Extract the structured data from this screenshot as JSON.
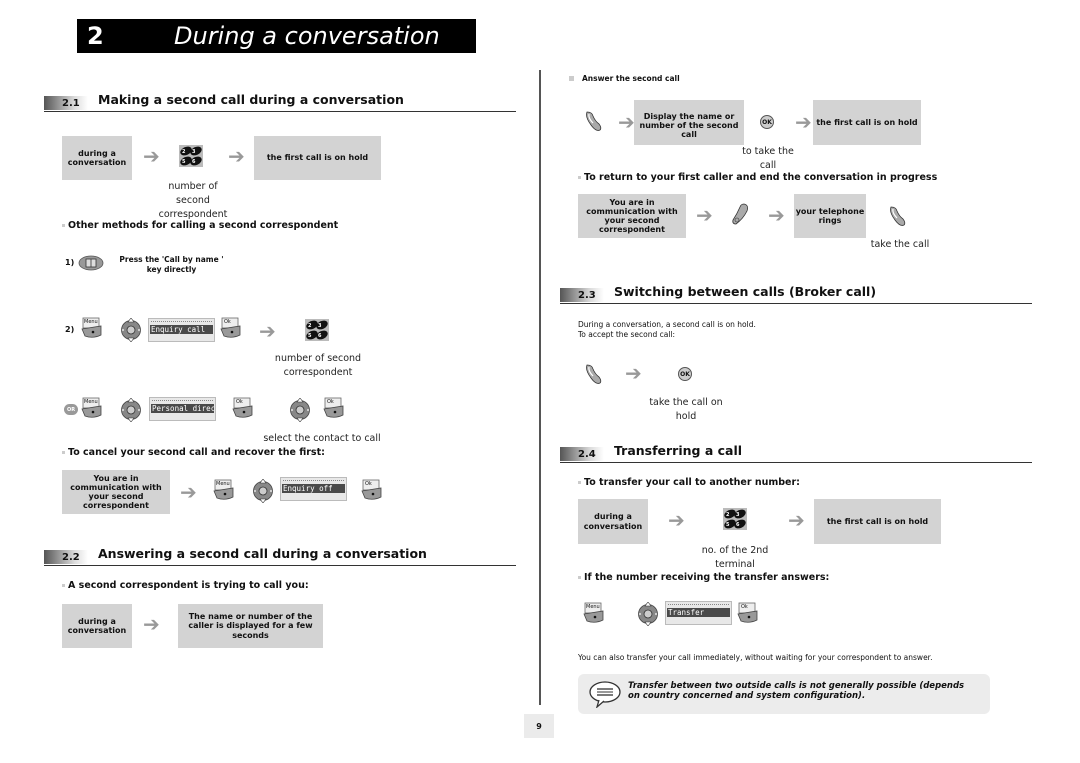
{
  "chapter": {
    "number": "2",
    "title": "During a conversation"
  },
  "sections": {
    "s21": {
      "number": "2.1",
      "title": "Making a second call during a conversation",
      "flow": {
        "box1": "during a conversation",
        "keypad_caption": "number of second correspondent",
        "box2": "the first call is on hold"
      },
      "bullet_other": "Other methods for calling a second correspondent",
      "method1": {
        "label": "1)",
        "text": "Press the 'Call by name ' key directly"
      },
      "method2": {
        "label": "2)",
        "menu_key": "Menu",
        "lcd": "Enquiry call",
        "ok_key": "Ok",
        "keypad_caption": "number of second correspondent"
      },
      "method_or": {
        "or_label": "OR",
        "menu_key": "Menu",
        "lcd": "Personal directory",
        "ok_key": "Ok",
        "ok_key2": "Ok",
        "caption": "select the contact to call"
      },
      "bullet_cancel": "To cancel your second call and recover the first:",
      "cancel": {
        "box": "You are in communication with your second correspondent",
        "menu_key": "Menu",
        "lcd": "Enquiry off",
        "ok_key": "Ok"
      }
    },
    "s22": {
      "number": "2.2",
      "title": "Answering a second call during a conversation",
      "bullet": "A second correspondent is trying to call you:",
      "box1": "during a conversation",
      "box2": "The name or number of the caller is displayed for a few seconds",
      "answer_heading": "Answer the second call",
      "answer_flow": {
        "box1": "Display the name or number of the second call",
        "ok_label": "OK",
        "ok_caption": "to take the call",
        "box2": "the first call is on hold"
      },
      "bullet_return": "To return to your first caller and end the conversation in progress",
      "return_flow": {
        "box1": "You are in communication with your second correspondent",
        "box2": "your telephone rings",
        "caption": "take the call"
      }
    },
    "s23": {
      "number": "2.3",
      "title": "Switching between calls (Broker call)",
      "body_line1": "During a conversation, a second call is on hold.",
      "body_line2": "To accept the second call:",
      "ok_label": "OK",
      "ok_caption": "take the call on hold"
    },
    "s24": {
      "number": "2.4",
      "title": "Transferring a call",
      "bullet_transfer": "To transfer your call to another number:",
      "flow": {
        "box1": "during a conversation",
        "keypad_caption": "no. of the 2nd terminal",
        "box2": "the first call is on hold"
      },
      "bullet_answers": "If the number receiving the transfer answers:",
      "answers": {
        "menu_key": "Menu",
        "lcd": "Transfer",
        "ok_key": "Ok"
      },
      "body": "You can also transfer your call immediately, without waiting for your correspondent to answer.",
      "note": "Transfer between two outside calls is not generally possible (depends on country concerned and system configuration)."
    }
  },
  "page_number": "9"
}
